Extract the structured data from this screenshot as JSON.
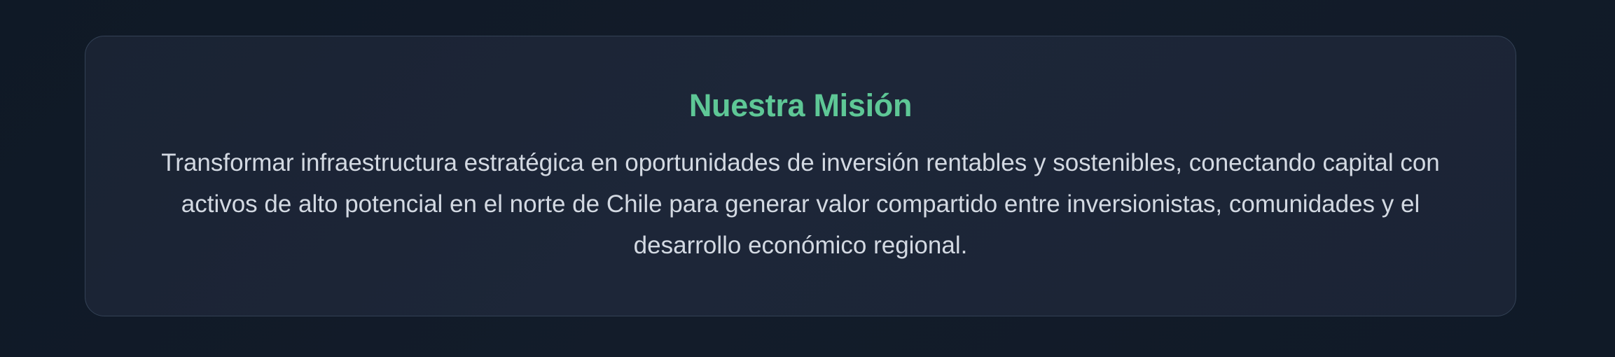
{
  "mission": {
    "title": "Nuestra Misión",
    "lines": [
      "Transformar infraestructura estratégica en oportunidades de inversión rentables y sostenibles, conectando capital con",
      "activos de alto potencial en el norte de Chile para generar valor compartido entre inversionistas, comunidades y el",
      "desarrollo económico regional."
    ]
  },
  "colors": {
    "title": "#5ec796",
    "text": "#d3d9e2",
    "card_border": "#334155",
    "page_background": "#111b28"
  }
}
